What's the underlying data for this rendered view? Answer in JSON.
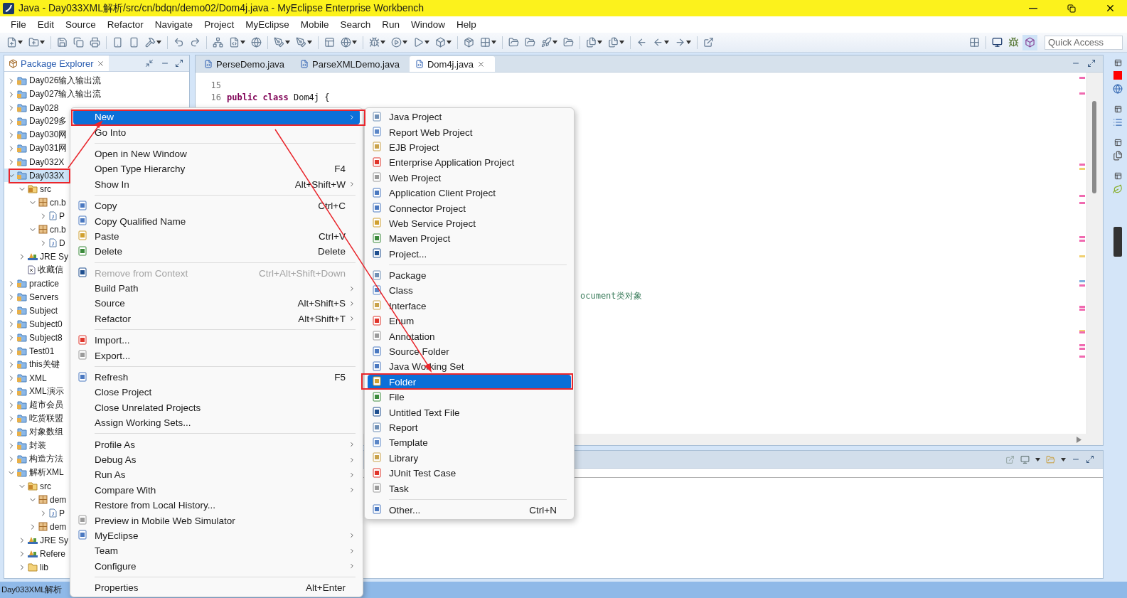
{
  "window": {
    "title": "Java - Day033XML解析/src/cn/bdqn/demo02/Dom4j.java - MyEclipse Enterprise Workbench"
  },
  "menu_bar": [
    "File",
    "Edit",
    "Source",
    "Refactor",
    "Navigate",
    "Project",
    "MyEclipse",
    "Mobile",
    "Search",
    "Run",
    "Window",
    "Help"
  ],
  "quick_access": {
    "placeholder": "Quick Access"
  },
  "package_explorer": {
    "title": "Package Explorer",
    "tree": [
      {
        "label": "Day026输入输出流",
        "kind": "project",
        "expanded": false,
        "selected": false
      },
      {
        "label": "Day027输入输出流",
        "kind": "project",
        "expanded": false,
        "selected": false
      },
      {
        "label": "Day028",
        "kind": "project",
        "expanded": false,
        "selected": false
      },
      {
        "label": "Day029多",
        "kind": "project",
        "expanded": false,
        "selected": false
      },
      {
        "label": "Day030网",
        "kind": "project",
        "expanded": false,
        "selected": false
      },
      {
        "label": "Day031网",
        "kind": "project",
        "expanded": false,
        "selected": false
      },
      {
        "label": "Day032X",
        "kind": "project",
        "expanded": false,
        "selected": false
      },
      {
        "label": "Day033X",
        "kind": "project",
        "expanded": true,
        "selected": true,
        "children": [
          {
            "label": "src",
            "kind": "source",
            "expanded": true,
            "selected": false,
            "children": [
              {
                "label": "cn.b",
                "kind": "package",
                "expanded": true,
                "selected": false,
                "children": [
                  {
                    "label": "P",
                    "kind": "file",
                    "expanded": false,
                    "selected": false
                  }
                ]
              },
              {
                "label": "cn.b",
                "kind": "package",
                "expanded": true,
                "selected": false,
                "children": [
                  {
                    "label": "D",
                    "kind": "file",
                    "expanded": false,
                    "selected": false
                  }
                ]
              }
            ]
          },
          {
            "label": "JRE Sy",
            "kind": "library",
            "expanded": false,
            "selected": false
          },
          {
            "label": "收藏信",
            "kind": "xml",
            "selected": false
          }
        ]
      },
      {
        "label": "practice",
        "kind": "project",
        "expanded": false,
        "selected": false
      },
      {
        "label": "Servers",
        "kind": "project",
        "expanded": false,
        "selected": false
      },
      {
        "label": "Subject",
        "kind": "project",
        "expanded": false,
        "selected": false
      },
      {
        "label": "Subject0",
        "kind": "project",
        "expanded": false,
        "selected": false
      },
      {
        "label": "Subject8",
        "kind": "project",
        "expanded": false,
        "selected": false
      },
      {
        "label": "Test01",
        "kind": "project",
        "expanded": false,
        "selected": false
      },
      {
        "label": "this关键",
        "kind": "project",
        "expanded": false,
        "selected": false
      },
      {
        "label": "XML",
        "kind": "project",
        "expanded": false,
        "selected": false
      },
      {
        "label": "XML演示",
        "kind": "project",
        "expanded": false,
        "selected": false
      },
      {
        "label": "超市会员",
        "kind": "project",
        "expanded": false,
        "selected": false
      },
      {
        "label": "吃货联盟",
        "kind": "project",
        "expanded": false,
        "selected": false
      },
      {
        "label": "对象数组",
        "kind": "project",
        "expanded": false,
        "selected": false
      },
      {
        "label": "封装",
        "kind": "project",
        "expanded": false,
        "selected": false
      },
      {
        "label": "构造方法",
        "kind": "project",
        "expanded": false,
        "selected": false
      },
      {
        "label": "解析XML",
        "kind": "project",
        "expanded": true,
        "selected": false,
        "children": [
          {
            "label": "src",
            "kind": "source",
            "expanded": true,
            "selected": false,
            "children": [
              {
                "label": "dem",
                "kind": "package",
                "expanded": true,
                "selected": false,
                "children": [
                  {
                    "label": "P",
                    "kind": "file",
                    "expanded": false,
                    "selected": false
                  }
                ]
              },
              {
                "label": "dem",
                "kind": "package",
                "expanded": false,
                "selected": false
              }
            ]
          },
          {
            "label": "JRE Sy",
            "kind": "library",
            "expanded": false,
            "selected": false
          },
          {
            "label": "Refere",
            "kind": "library",
            "expanded": false,
            "selected": false
          },
          {
            "label": "lib",
            "kind": "folder",
            "expanded": false,
            "selected": false
          }
        ]
      }
    ]
  },
  "editor": {
    "tabs": [
      {
        "label": "PerseDemo.java",
        "selected": false
      },
      {
        "label": "ParseXMLDemo.java",
        "selected": false
      },
      {
        "label": "Dom4j.java",
        "selected": true
      }
    ],
    "lines": [
      {
        "number": "15"
      },
      {
        "number": "16",
        "tokens": [
          {
            "kind": "keyword",
            "text": "public class"
          },
          {
            "kind": "plain",
            "text": " Dom4j {"
          }
        ]
      }
    ],
    "comment_fragment": "ocument类对象"
  },
  "context_menu": {
    "items": [
      {
        "kind": "item",
        "label": "New",
        "submenu": true,
        "selected": true,
        "disabled": false
      },
      {
        "kind": "item",
        "label": "Go Into",
        "selected": false,
        "disabled": false
      },
      {
        "kind": "separator"
      },
      {
        "kind": "item",
        "label": "Open in New Window",
        "selected": false,
        "disabled": false
      },
      {
        "kind": "item",
        "label": "Open Type Hierarchy",
        "shortcut": "F4",
        "selected": false,
        "disabled": false
      },
      {
        "kind": "item",
        "label": "Show In",
        "shortcut": "Alt+Shift+W",
        "submenu": true,
        "selected": false,
        "disabled": false
      },
      {
        "kind": "separator"
      },
      {
        "kind": "item",
        "label": "Copy",
        "shortcut": "Ctrl+C",
        "icon": true,
        "selected": false,
        "disabled": false
      },
      {
        "kind": "item",
        "label": "Copy Qualified Name",
        "icon": true,
        "selected": false,
        "disabled": false
      },
      {
        "kind": "item",
        "label": "Paste",
        "shortcut": "Ctrl+V",
        "icon": true,
        "selected": false,
        "disabled": false
      },
      {
        "kind": "item",
        "label": "Delete",
        "shortcut": "Delete",
        "icon": true,
        "selected": false,
        "disabled": false
      },
      {
        "kind": "separator"
      },
      {
        "kind": "item",
        "label": "Remove from Context",
        "shortcut": "Ctrl+Alt+Shift+Down",
        "icon": true,
        "selected": false,
        "disabled": true
      },
      {
        "kind": "item",
        "label": "Build Path",
        "submenu": true,
        "selected": false,
        "disabled": false
      },
      {
        "kind": "item",
        "label": "Source",
        "shortcut": "Alt+Shift+S",
        "submenu": true,
        "selected": false,
        "disabled": false
      },
      {
        "kind": "item",
        "label": "Refactor",
        "shortcut": "Alt+Shift+T",
        "submenu": true,
        "selected": false,
        "disabled": false
      },
      {
        "kind": "separator"
      },
      {
        "kind": "item",
        "label": "Import...",
        "icon": true,
        "selected": false,
        "disabled": false
      },
      {
        "kind": "item",
        "label": "Export...",
        "icon": true,
        "selected": false,
        "disabled": false
      },
      {
        "kind": "separator"
      },
      {
        "kind": "item",
        "label": "Refresh",
        "shortcut": "F5",
        "icon": true,
        "selected": false,
        "disabled": false
      },
      {
        "kind": "item",
        "label": "Close Project",
        "selected": false,
        "disabled": false
      },
      {
        "kind": "item",
        "label": "Close Unrelated Projects",
        "selected": false,
        "disabled": false
      },
      {
        "kind": "item",
        "label": "Assign Working Sets...",
        "selected": false,
        "disabled": false
      },
      {
        "kind": "separator"
      },
      {
        "kind": "item",
        "label": "Profile As",
        "submenu": true,
        "selected": false,
        "disabled": false
      },
      {
        "kind": "item",
        "label": "Debug As",
        "submenu": true,
        "selected": false,
        "disabled": false
      },
      {
        "kind": "item",
        "label": "Run As",
        "submenu": true,
        "selected": false,
        "disabled": false
      },
      {
        "kind": "item",
        "label": "Compare With",
        "submenu": true,
        "selected": false,
        "disabled": false
      },
      {
        "kind": "item",
        "label": "Restore from Local History...",
        "selected": false,
        "disabled": false
      },
      {
        "kind": "item",
        "label": "Preview in Mobile Web Simulator",
        "icon": true,
        "selected": false,
        "disabled": false
      },
      {
        "kind": "item",
        "label": "MyEclipse",
        "icon": true,
        "submenu": true,
        "selected": false,
        "disabled": false
      },
      {
        "kind": "item",
        "label": "Team",
        "submenu": true,
        "selected": false,
        "disabled": false
      },
      {
        "kind": "item",
        "label": "Configure",
        "submenu": true,
        "selected": false,
        "disabled": false
      },
      {
        "kind": "separator"
      },
      {
        "kind": "item",
        "label": "Properties",
        "shortcut": "Alt+Enter",
        "selected": false,
        "disabled": false
      }
    ]
  },
  "new_submenu": {
    "items": [
      {
        "kind": "item",
        "label": "Java Project",
        "selected": false
      },
      {
        "kind": "item",
        "label": "Report Web Project",
        "selected": false
      },
      {
        "kind": "item",
        "label": "EJB Project",
        "selected": false
      },
      {
        "kind": "item",
        "label": "Enterprise Application Project",
        "selected": false
      },
      {
        "kind": "item",
        "label": "Web Project",
        "selected": false
      },
      {
        "kind": "item",
        "label": "Application Client Project",
        "selected": false
      },
      {
        "kind": "item",
        "label": "Connector Project",
        "selected": false
      },
      {
        "kind": "item",
        "label": "Web Service Project",
        "selected": false
      },
      {
        "kind": "item",
        "label": "Maven Project",
        "selected": false
      },
      {
        "kind": "item",
        "label": "Project...",
        "selected": false
      },
      {
        "kind": "separator"
      },
      {
        "kind": "item",
        "label": "Package",
        "selected": false
      },
      {
        "kind": "item",
        "label": "Class",
        "selected": false
      },
      {
        "kind": "item",
        "label": "Interface",
        "selected": false
      },
      {
        "kind": "item",
        "label": "Enum",
        "selected": false
      },
      {
        "kind": "item",
        "label": "Annotation",
        "selected": false
      },
      {
        "kind": "item",
        "label": "Source Folder",
        "selected": false
      },
      {
        "kind": "item",
        "label": "Java Working Set",
        "selected": false
      },
      {
        "kind": "item",
        "label": "Folder",
        "selected": true
      },
      {
        "kind": "item",
        "label": "File",
        "selected": false
      },
      {
        "kind": "item",
        "label": "Untitled Text File",
        "selected": false
      },
      {
        "kind": "item",
        "label": "Report",
        "selected": false
      },
      {
        "kind": "item",
        "label": "Template",
        "selected": false
      },
      {
        "kind": "item",
        "label": "Library",
        "selected": false
      },
      {
        "kind": "item",
        "label": "JUnit Test Case",
        "selected": false
      },
      {
        "kind": "item",
        "label": "Task",
        "selected": false
      },
      {
        "kind": "separator"
      },
      {
        "kind": "item",
        "label": "Other...",
        "shortcut": "Ctrl+N",
        "selected": false
      }
    ]
  },
  "status_bar": {
    "text": "Day033XML解析"
  }
}
